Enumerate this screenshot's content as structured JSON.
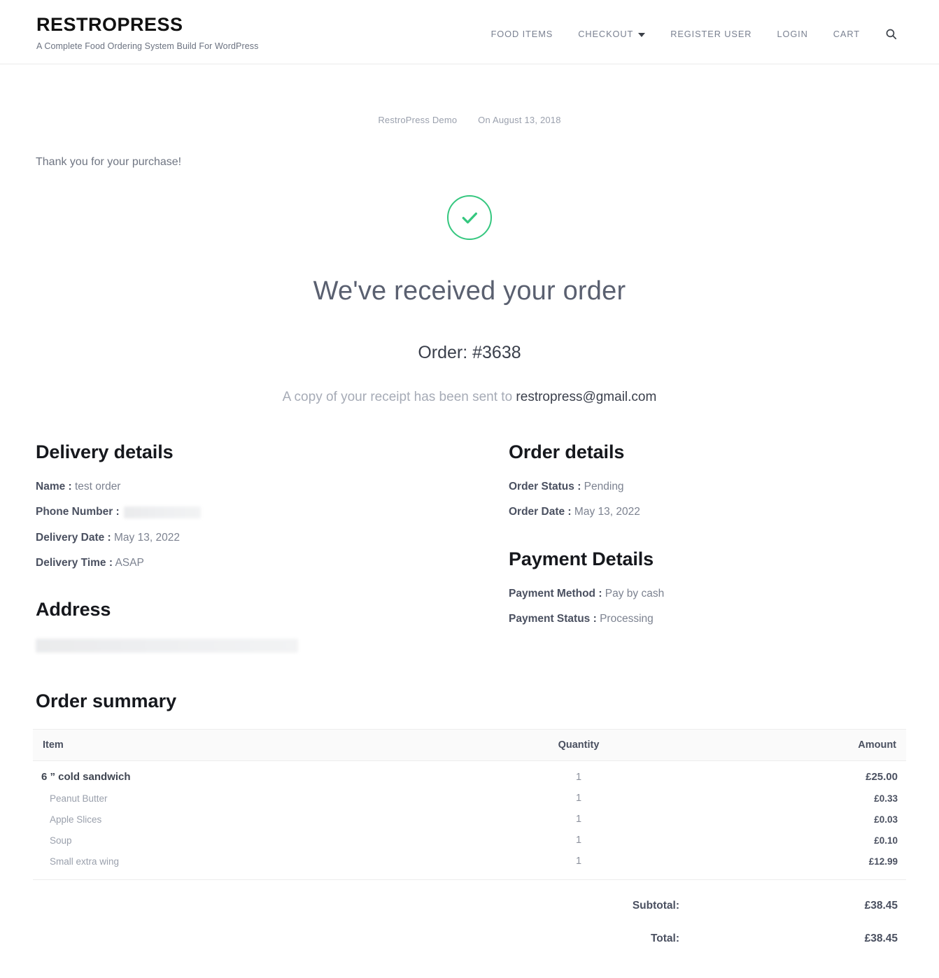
{
  "header": {
    "brand_title": "RESTROPRESS",
    "brand_tagline": "A Complete Food Ordering System Build For WordPress",
    "nav": [
      {
        "label": "FOOD ITEMS",
        "has_caret": false
      },
      {
        "label": "CHECKOUT",
        "has_caret": true
      },
      {
        "label": "REGISTER USER",
        "has_caret": false
      },
      {
        "label": "LOGIN",
        "has_caret": false
      },
      {
        "label": "CART",
        "has_caret": false
      }
    ],
    "search_icon": "search-icon"
  },
  "entry_meta": {
    "author": "RestroPress Demo",
    "date": "On August 13, 2018"
  },
  "confirmation": {
    "thank_you": "Thank you for your purchase!",
    "success_icon": "check-circle-icon",
    "success_color": "#35c77f",
    "headline": "We've received your order",
    "order_number": "Order: #3638",
    "receipt_prefix": "A copy of your receipt has been sent to ",
    "receipt_email": "restropress@gmail.com"
  },
  "delivery_details": {
    "title": "Delivery details",
    "fields": [
      {
        "label": "Name :",
        "value": "test order",
        "redacted": false
      },
      {
        "label": "Phone Number :",
        "value": "",
        "redacted": true
      },
      {
        "label": "Delivery Date :",
        "value": "May 13, 2022",
        "redacted": false
      },
      {
        "label": "Delivery Time :",
        "value": "ASAP",
        "redacted": false
      }
    ]
  },
  "address": {
    "title": "Address",
    "value": "",
    "redacted": true
  },
  "order_details": {
    "title": "Order details",
    "fields": [
      {
        "label": "Order Status :",
        "value": "Pending"
      },
      {
        "label": "Order Date :",
        "value": "May 13, 2022"
      }
    ]
  },
  "payment_details": {
    "title": "Payment Details",
    "fields": [
      {
        "label": "Payment Method :",
        "value": "Pay by cash"
      },
      {
        "label": "Payment Status :",
        "value": "Processing"
      }
    ]
  },
  "order_summary": {
    "title": "Order summary",
    "columns": [
      "Item",
      "Quantity",
      "Amount"
    ],
    "rows": [
      {
        "item": "6 ” cold sandwich",
        "quantity": "1",
        "amount": "£25.00",
        "type": "main"
      },
      {
        "item": "Peanut Butter",
        "quantity": "1",
        "amount": "£0.33",
        "type": "addon"
      },
      {
        "item": "Apple Slices",
        "quantity": "1",
        "amount": "£0.03",
        "type": "addon"
      },
      {
        "item": "Soup",
        "quantity": "1",
        "amount": "£0.10",
        "type": "addon"
      },
      {
        "item": "Small extra wing",
        "quantity": "1",
        "amount": "£12.99",
        "type": "addon"
      }
    ],
    "subtotal_label": "Subtotal:",
    "subtotal_value": "£38.45",
    "total_label": "Total:",
    "total_value": "£38.45"
  }
}
